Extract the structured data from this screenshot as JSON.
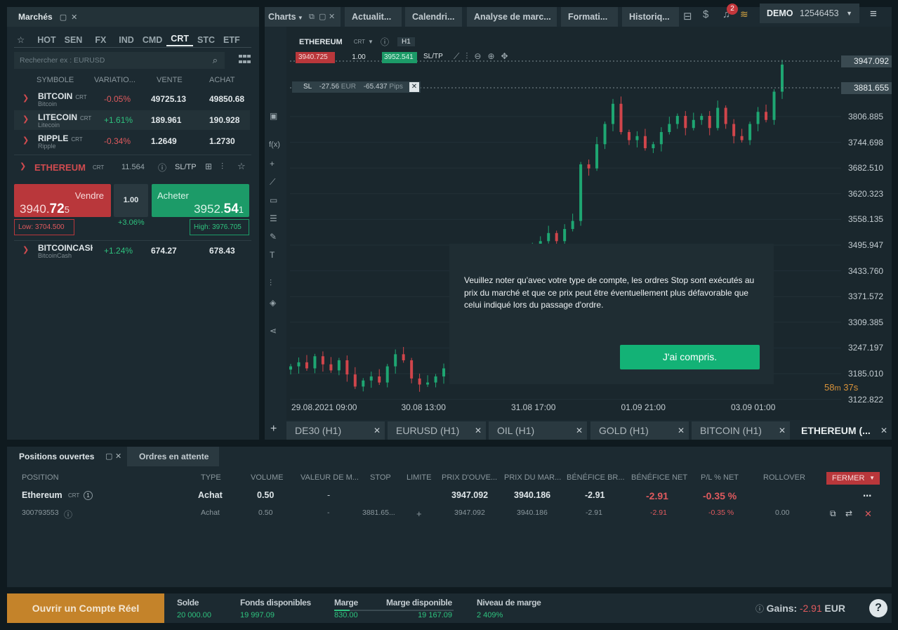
{
  "markets": {
    "title": "Marchés",
    "categories": [
      "HOT",
      "SEN",
      "FX",
      "IND",
      "CMD",
      "CRT",
      "STC",
      "ETF"
    ],
    "active_category": "CRT",
    "search_placeholder": "Rechercher ex : EURUSD",
    "columns": [
      "SYMBOLE",
      "VARIATIO...",
      "VENTE",
      "ACHAT"
    ],
    "rows": [
      {
        "symbol": "BITCOIN",
        "tag": "CRT",
        "sub": "Bitcoin",
        "change": "-0.05%",
        "sell": "49725.13",
        "buy": "49850.68",
        "dir": "neg"
      },
      {
        "symbol": "LITECOIN",
        "tag": "CRT",
        "sub": "Litecoin",
        "change": "+1.61%",
        "sell": "189.961",
        "buy": "190.928",
        "dir": "pos"
      },
      {
        "symbol": "RIPPLE",
        "tag": "CRT",
        "sub": "Ripple",
        "change": "-0.34%",
        "sell": "1.2649",
        "buy": "1.2730",
        "dir": "neg"
      }
    ],
    "expanded": {
      "symbol": "ETHEREUM",
      "tag": "CRT",
      "spread": "11.564",
      "sltp": "SL/TP",
      "sell_label": "Vendre",
      "sell_price_main": "3940.",
      "sell_price_big": "72",
      "sell_price_tail": "5",
      "buy_label": "Acheter",
      "buy_price_main": "3952.",
      "buy_price_big": "54",
      "buy_price_tail": "1",
      "qty": "1.00",
      "change": "+3.06%",
      "low": "Low: 3704.500",
      "high": "High: 3976.705"
    },
    "row_after": {
      "symbol": "BITCOINCASH",
      "tag": "",
      "sub": "BitcoinCash",
      "change": "+1.24%",
      "sell": "674.27",
      "buy": "678.43",
      "dir": "pos"
    }
  },
  "chart": {
    "tabs": [
      "Charts",
      "Actualit...",
      "Calendri...",
      "Analyse de marc...",
      "Formati...",
      "Historiq..."
    ],
    "notif_count": "2",
    "account_mode": "DEMO",
    "account_id": "12546453",
    "instrument": "ETHEREUM",
    "instrument_tag": "CRT",
    "timeframe": "H1",
    "sell_price": "3940.725",
    "qty": "1.00",
    "buy_price": "3952.541",
    "sltp": "SL/TP",
    "sl_label": "SL",
    "sl_eur": "-27.56",
    "sl_eur_unit": "EUR",
    "sl_pips": "-65.437",
    "sl_pips_unit": "Pips",
    "price_current": "3947.092",
    "price_sl": "3881.655",
    "y_ticks": [
      "3806.885",
      "3744.698",
      "3682.510",
      "3620.323",
      "3558.135",
      "3495.947",
      "3433.760",
      "3371.572",
      "3309.385",
      "3247.197",
      "3185.010",
      "3122.822"
    ],
    "x_ticks": [
      "29.08.2021 09:00",
      "30.08 13:00",
      "31.08 17:00",
      "01.09 21:00",
      "03.09 01:00"
    ],
    "timer_min": "58",
    "timer_min_unit": "m",
    "timer_sec": "37s",
    "bottom_tabs": [
      "DE30 (H1)",
      "EURUSD (H1)",
      "OIL (H1)",
      "GOLD (H1)",
      "BITCOIN (H1)",
      "ETHEREUM (..."
    ],
    "colors": {
      "up": "#1ea672",
      "down": "#d0454b"
    }
  },
  "chart_data": {
    "type": "candlestick",
    "x": [
      "29.08.2021 09:00",
      "30.08 13:00",
      "31.08 17:00",
      "01.09 21:00",
      "03.09 01:00"
    ],
    "ylim": [
      3122.822,
      3980
    ],
    "closes": [
      3200,
      3210,
      3195,
      3225,
      3205,
      3190,
      3215,
      3180,
      3150,
      3165,
      3175,
      3160,
      3200,
      3230,
      3215,
      3170,
      3155,
      3160,
      3175,
      3195,
      3180,
      3200,
      3250,
      3270,
      3330,
      3320,
      3370,
      3390,
      3350,
      3380,
      3500,
      3510,
      3530,
      3510,
      3540,
      3560,
      3700,
      3690,
      3750,
      3800,
      3850,
      3780,
      3760,
      3770,
      3740,
      3750,
      3780,
      3800,
      3820,
      3790,
      3810,
      3820,
      3790,
      3840,
      3800,
      3770,
      3760,
      3800,
      3830,
      3810,
      3880,
      3947
    ]
  },
  "modal": {
    "message": "Veuillez noter qu'avec votre type de compte, les ordres Stop sont exécutés au prix du marché et que ce prix peut être éventuellement plus défavorable que celui indiqué lors du passage d'ordre.",
    "button": "J'ai compris."
  },
  "positions": {
    "tabs": [
      "Positions ouvertes",
      "Ordres en attente"
    ],
    "columns": [
      "POSITION",
      "TYPE",
      "VOLUME",
      "VALEUR DE M...",
      "STOP",
      "LIMITE",
      "PRIX D'OUVE...",
      "PRIX DU MAR...",
      "BÉNÉFICE BR...",
      "BÉNÉFICE NET",
      "P/L % NET",
      "ROLLOVER"
    ],
    "close_button": "FERMER",
    "group": {
      "name": "Ethereum",
      "tag": "CRT",
      "count": "1",
      "type": "Achat",
      "volume": "0.50",
      "value": "-",
      "open": "3947.092",
      "market": "3940.186",
      "gross": "-2.91",
      "net": "-2.91",
      "pl": "-0.35 %"
    },
    "detail": {
      "id": "300793553",
      "type": "Achat",
      "volume": "0.50",
      "value": "-",
      "stop": "3881.65...",
      "limit": "+",
      "open": "3947.092",
      "market": "3940.186",
      "gross": "-2.91",
      "net": "-2.91",
      "pl": "-0.35 %",
      "rollover": "0.00"
    }
  },
  "footer": {
    "real_account": "Ouvrir un Compte Réel",
    "stats": [
      {
        "label": "Solde",
        "value": "20 000.00"
      },
      {
        "label": "Fonds disponibles",
        "value": "19 997.09"
      },
      {
        "label": "Marge",
        "value": "830.00"
      },
      {
        "label": "Marge disponible",
        "value": "19 167.09"
      },
      {
        "label": "Niveau de marge",
        "value": "2 409%"
      }
    ],
    "gains_label": "Gains:",
    "gains_value": "-2.91",
    "gains_unit": "EUR"
  }
}
